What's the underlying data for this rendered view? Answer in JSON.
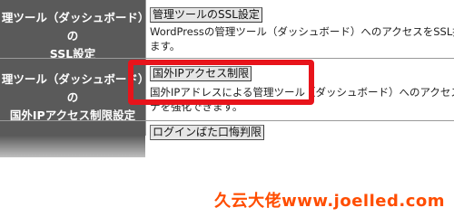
{
  "rows": [
    {
      "label_lines": [
        "理ツール（ダッシュボード）の",
        "SSL設定"
      ],
      "button": "管理ツールのSSL設定",
      "desc_lines": [
        "WordPressの管理ツール（ダッシュボード）へのアクセスをSSL接続",
        "ます。"
      ]
    },
    {
      "label_lines": [
        "理ツール（ダッシュボード）の",
        "国外IPアクセス制限設定"
      ],
      "button": "国外IPアクセス制限",
      "desc_lines": [
        "国外IPアドレスによる管理ツール（ダッシュボード）へのアクセス制限",
        "ナを強化できます。"
      ]
    },
    {
      "label_lines": [
        ""
      ],
      "button": "ログインばた口悔判限",
      "desc_lines": []
    }
  ],
  "watermark": "久云大佬www.joelled.com",
  "colors": {
    "label_bg": "#5a5a5a",
    "highlight": "#e8141b",
    "watermark": "#ff4d00"
  }
}
